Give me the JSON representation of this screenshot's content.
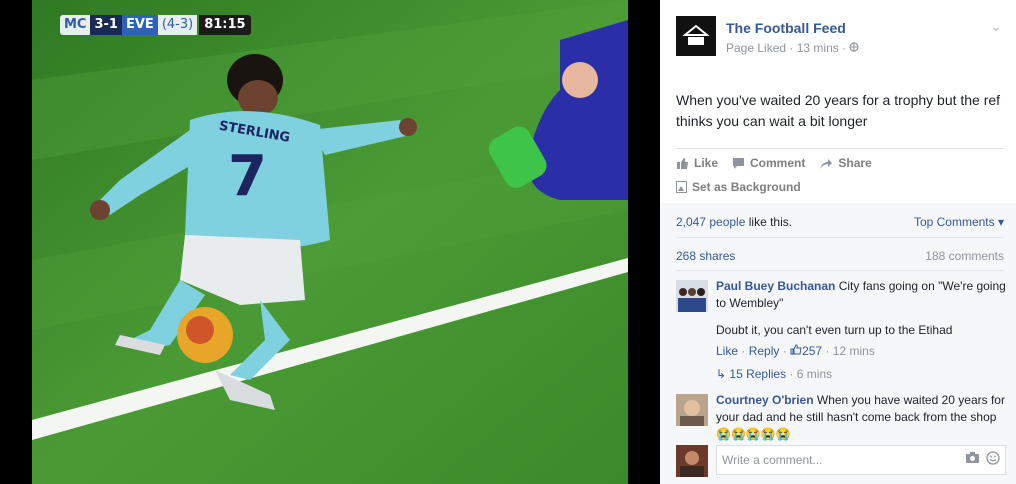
{
  "scorebug": {
    "team1": "MC",
    "score": "3-1",
    "team2": "EVE",
    "aggregate": "(4-3)",
    "clock": "81:15"
  },
  "player": {
    "name": "STERLING",
    "number": "7"
  },
  "post": {
    "page_name": "The Football Feed",
    "page_status": "Page Liked",
    "time": "13 mins",
    "text": "When you've waited 20 years for a trophy but the ref thinks you can wait a bit longer",
    "actions": {
      "like": "Like",
      "comment": "Comment",
      "share": "Share",
      "set_bg": "Set as Background"
    }
  },
  "stats": {
    "likes_count": "2,047 people",
    "likes_suffix": "like this.",
    "top_comments": "Top Comments",
    "shares": "268 shares",
    "comments_count": "188 comments"
  },
  "comments": [
    {
      "author": "Paul Buey Buchanan",
      "text": "City fans going on \"We're going to Wembley\"",
      "text2": "Doubt it, you can't even turn up to the Etihad",
      "like": "Like",
      "reply": "Reply",
      "likes": "257",
      "time": "12 mins",
      "replies": "15 Replies",
      "replies_time": "6 mins"
    },
    {
      "author": "Courtney O'brien",
      "text": "When you have waited 20 years for your dad and he still hasn't come back from the shop",
      "emoji": "😭😭😭😭😭"
    }
  ],
  "composer": {
    "placeholder": "Write a comment..."
  },
  "colors": {
    "link": "#365899",
    "muted": "#90949c",
    "pitch": "#3f8a2c"
  },
  "icons": [
    "chevron-down-icon",
    "globe-icon",
    "thumbs-up-icon",
    "comment-icon",
    "share-icon",
    "picture-icon",
    "reply-arrow-icon",
    "camera-icon",
    "smiley-icon"
  ]
}
